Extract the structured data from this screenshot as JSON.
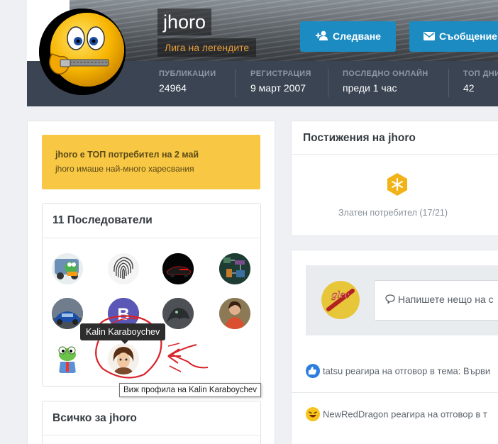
{
  "profile": {
    "username": "jhoro",
    "title": "Лига на легендите",
    "follow_label": "Следване",
    "message_label": "Съобщение",
    "stats": [
      {
        "label": "ПУБЛИКАЦИИ",
        "value": "24964"
      },
      {
        "label": "РЕГИСТРАЦИЯ",
        "value": "9 март 2007"
      },
      {
        "label": "ПОСЛЕДНО ОНЛАЙН",
        "value": "преди 1 час"
      },
      {
        "label": "ТОП ДНИ",
        "value": "42"
      }
    ]
  },
  "top_notice": {
    "line1": "jhoro е ТОП потребител на 2 май",
    "line2": "jhoro имаше най-много харесвания"
  },
  "followers": {
    "title": "11 Последователи",
    "tooltip_name": "Kalin Karaboychev",
    "tooltip_profile": "Виж профила на Kalin Karaboychev",
    "letter_avatar": "B"
  },
  "about": {
    "title": "Всичко за jhoro"
  },
  "achievements": {
    "title": "Постижения на jhoro",
    "badge_label": "Златен потребител (17/21)"
  },
  "feed": {
    "status_placeholder": "Напишете нещо на с",
    "status_avatar_text": "glee",
    "activities": [
      {
        "user": "tatsu",
        "text": "реагира на отговор в тема: Върви",
        "reaction": "like"
      },
      {
        "user": "NewRedDragon",
        "text": "реагира на отговор в т",
        "reaction": "haha"
      }
    ]
  },
  "colors": {
    "accent": "#1b8bc2",
    "header_dark": "#3a4453",
    "notice_yellow": "#f8c744",
    "annotation_red": "#d9232a",
    "badge_gold": "#f2b318"
  }
}
